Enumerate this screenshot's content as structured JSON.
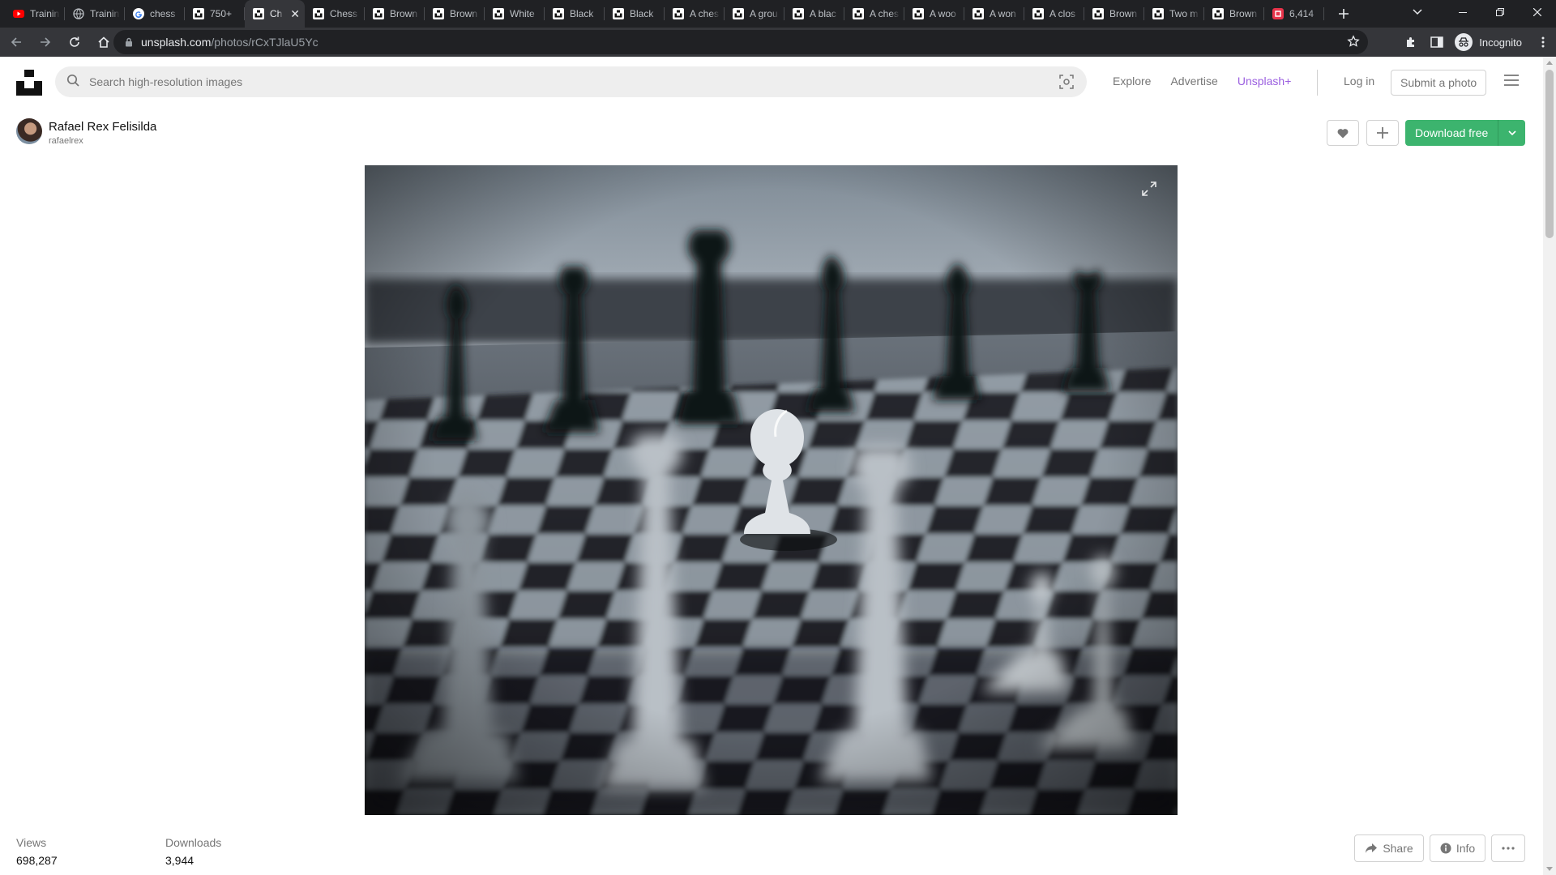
{
  "browser": {
    "tabs": [
      {
        "title": "Trainin",
        "favicon": "youtube-icon",
        "active": false
      },
      {
        "title": "Trainin",
        "favicon": "globe-icon",
        "active": false
      },
      {
        "title": "chess",
        "favicon": "google-icon",
        "active": false
      },
      {
        "title": "750+",
        "favicon": "unsplash-icon",
        "active": false
      },
      {
        "title": "Ch",
        "favicon": "unsplash-icon",
        "active": true
      },
      {
        "title": "Chess",
        "favicon": "unsplash-icon",
        "active": false
      },
      {
        "title": "Brown",
        "favicon": "unsplash-icon",
        "active": false
      },
      {
        "title": "Brown",
        "favicon": "unsplash-icon",
        "active": false
      },
      {
        "title": "White",
        "favicon": "unsplash-icon",
        "active": false
      },
      {
        "title": "Black",
        "favicon": "unsplash-icon",
        "active": false
      },
      {
        "title": "Black",
        "favicon": "unsplash-icon",
        "active": false
      },
      {
        "title": "A ches",
        "favicon": "unsplash-icon",
        "active": false
      },
      {
        "title": "A grou",
        "favicon": "unsplash-icon",
        "active": false
      },
      {
        "title": "A blac",
        "favicon": "unsplash-icon",
        "active": false
      },
      {
        "title": "A ches",
        "favicon": "unsplash-icon",
        "active": false
      },
      {
        "title": "A woo",
        "favicon": "unsplash-icon",
        "active": false
      },
      {
        "title": "A won",
        "favicon": "unsplash-icon",
        "active": false
      },
      {
        "title": "A clos",
        "favicon": "unsplash-icon",
        "active": false
      },
      {
        "title": "Brown",
        "favicon": "unsplash-icon",
        "active": false
      },
      {
        "title": "Two m",
        "favicon": "unsplash-icon",
        "active": false
      },
      {
        "title": "Brown",
        "favicon": "unsplash-icon",
        "active": false
      },
      {
        "title": "6,414",
        "favicon": "red-app-icon",
        "active": false
      }
    ],
    "url_host": "unsplash.com",
    "url_path": "/photos/rCxTJlaU5Yc",
    "profile_label": "Incognito"
  },
  "header": {
    "search_placeholder": "Search high-resolution images",
    "nav": {
      "explore": "Explore",
      "advertise": "Advertise",
      "unsplash_plus": "Unsplash+"
    },
    "login": "Log in",
    "submit": "Submit a photo"
  },
  "photographer": {
    "name": "Rafael Rex Felisilda",
    "handle": "rafaelrex"
  },
  "actions": {
    "download": "Download free",
    "share": "Share",
    "info": "Info"
  },
  "stats": {
    "views_label": "Views",
    "views_value": "698,287",
    "downloads_label": "Downloads",
    "downloads_value": "3,944"
  },
  "colors": {
    "accent_green": "#3cb46e",
    "unsplash_plus": "#9b5fe0",
    "chrome_dark": "#202124"
  }
}
